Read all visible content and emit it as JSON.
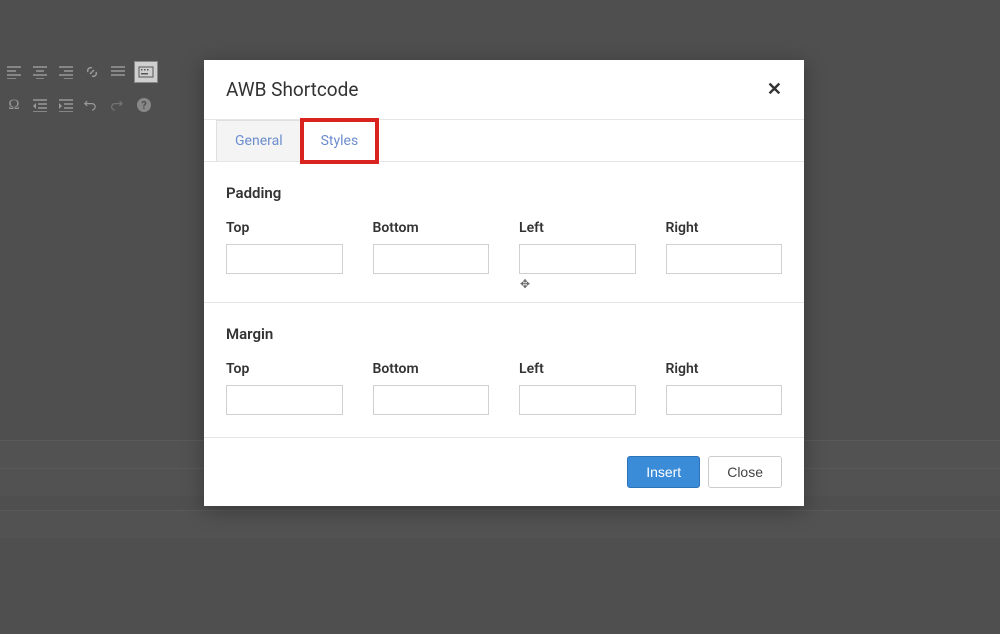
{
  "modal": {
    "title": "AWB Shortcode",
    "tabs": {
      "general": "General",
      "styles": "Styles"
    },
    "sections": {
      "padding": "Padding",
      "margin": "Margin"
    },
    "fields": {
      "top": "Top",
      "bottom": "Bottom",
      "left": "Left",
      "right": "Right"
    },
    "values": {
      "padding": {
        "top": "",
        "bottom": "",
        "left": "",
        "right": ""
      },
      "margin": {
        "top": "",
        "bottom": "",
        "left": "",
        "right": ""
      }
    },
    "buttons": {
      "insert": "Insert",
      "close": "Close"
    }
  }
}
